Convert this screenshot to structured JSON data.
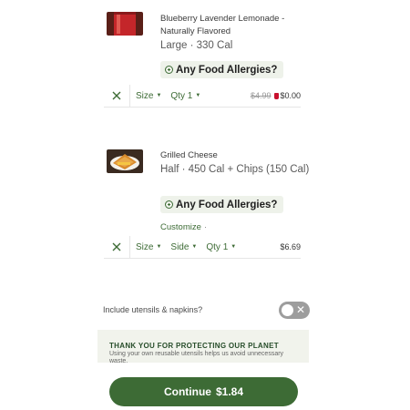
{
  "items": [
    {
      "name": "Blueberry Lavender Lemonade - Naturally Flavored",
      "description": "Large · 330 Cal",
      "allergy_label": "Any Food Allergies?",
      "controls": {
        "size_label": "Size",
        "qty_label": "Qty 1",
        "old_price": "$4.99",
        "price": "$0.00"
      }
    },
    {
      "name": "Grilled Cheese",
      "description": "Half · 450 Cal + Chips (150 Cal)",
      "allergy_label": "Any Food Allergies?",
      "customize_label": "Customize",
      "customize_sep": "·",
      "controls": {
        "size_label": "Size",
        "side_label": "Side",
        "qty_label": "Qty 1",
        "price": "$6.69"
      }
    }
  ],
  "utensils": {
    "label": "Include utensils & napkins?",
    "toggle_on": false
  },
  "banner": {
    "title": "THANK YOU FOR PROTECTING OUR PLANET",
    "text": "Using your own reusable utensils helps us avoid unnecessary waste."
  },
  "checkout": {
    "label": "Continue",
    "amount": "$1.84"
  },
  "colors": {
    "accent": "#3d6b35",
    "banner_bg": "#f1f3ec",
    "toggle_off": "#9d9d9d"
  }
}
